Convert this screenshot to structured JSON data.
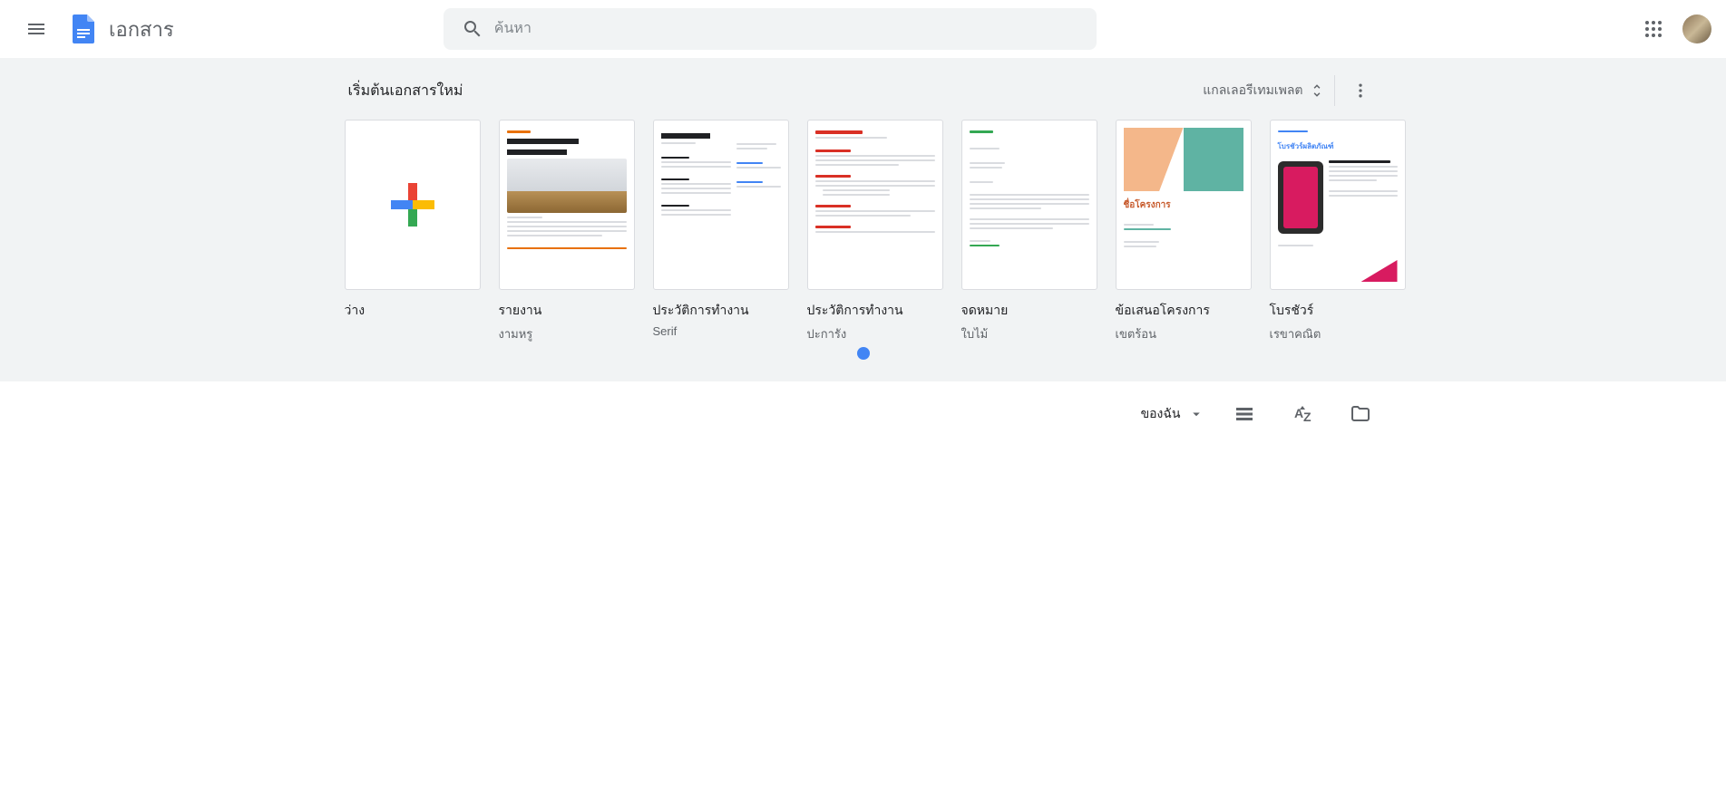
{
  "header": {
    "app_title": "เอกสาร",
    "search_placeholder": "ค้นหา"
  },
  "templates_strip": {
    "title": "เริ่มต้นเอกสารใหม่",
    "gallery_label": "แกลเลอรีเทมเพลต"
  },
  "templates": [
    {
      "title": "ว่าง",
      "subtitle": ""
    },
    {
      "title": "รายงาน",
      "subtitle": "งามหรู"
    },
    {
      "title": "ประวัติการทำงาน",
      "subtitle": "Serif"
    },
    {
      "title": "ประวัติการทำงาน",
      "subtitle": "ปะการัง"
    },
    {
      "title": "จดหมาย",
      "subtitle": "ใบไม้"
    },
    {
      "title": "ข้อเสนอโครงการ",
      "subtitle": "เขตร้อน"
    },
    {
      "title": "โบรชัวร์",
      "subtitle": "เรขาคณิต"
    }
  ],
  "docs_toolbar": {
    "owner_label": "ของฉัน"
  }
}
